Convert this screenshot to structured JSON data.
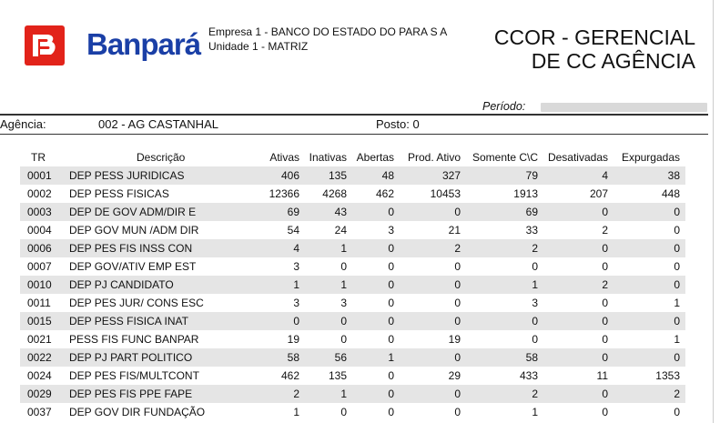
{
  "header": {
    "logo_text": "Banpará",
    "company_label": "Empresa 1 - ",
    "company_name": "BANCO DO ESTADO DO PARA S A",
    "unit_label": "Unidade 1 - ",
    "unit_name": "MATRIZ",
    "report_title_line1": "CCOR - GERENCIAL",
    "report_title_line2": "DE CC AGÊNCIA"
  },
  "filters": {
    "periodo_label": "Período:",
    "agencia_label": "Agência:",
    "agencia_value": "002 - AG CASTANHAL",
    "posto_label": "Posto:",
    "posto_value": "0"
  },
  "colors": {
    "logo_red": "#e2231a",
    "logo_blue": "#1a3fa6",
    "row_shade": "#e5e5e5"
  },
  "table": {
    "headers": [
      "TR",
      "Descrição",
      "Ativas",
      "Inativas",
      "Abertas",
      "Prod. Ativo",
      "Somente C\\C",
      "Desativadas",
      "Expurgadas"
    ],
    "rows": [
      [
        "0001",
        "DEP PESS JURIDICAS",
        "406",
        "135",
        "48",
        "327",
        "79",
        "4",
        "38"
      ],
      [
        "0002",
        "DEP PESS FISICAS",
        "12366",
        "4268",
        "462",
        "10453",
        "1913",
        "207",
        "448"
      ],
      [
        "0003",
        "DEP DE GOV  ADM/DIR E",
        "69",
        "43",
        "0",
        "0",
        "69",
        "0",
        "0"
      ],
      [
        "0004",
        "DEP GOV MUN /ADM DIR",
        "54",
        "24",
        "3",
        "21",
        "33",
        "2",
        "0"
      ],
      [
        "0006",
        "DEP PES FIS INSS CON",
        "4",
        "1",
        "0",
        "2",
        "2",
        "0",
        "0"
      ],
      [
        "0007",
        "DEP GOV/ATIV EMP EST",
        "3",
        "0",
        "0",
        "0",
        "0",
        "0",
        "0"
      ],
      [
        "0010",
        "DEP PJ CANDIDATO",
        "1",
        "1",
        "0",
        "0",
        "1",
        "2",
        "0"
      ],
      [
        "0011",
        "DEP PES JUR/ CONS ESC",
        "3",
        "3",
        "0",
        "0",
        "3",
        "0",
        "1"
      ],
      [
        "0015",
        "DEP PESS FISICA INAT",
        "0",
        "0",
        "0",
        "0",
        "0",
        "0",
        "0"
      ],
      [
        "0021",
        "PESS FIS FUNC BANPAR",
        "19",
        "0",
        "0",
        "19",
        "0",
        "0",
        "1"
      ],
      [
        "0022",
        "DEP PJ PART POLITICO",
        "58",
        "56",
        "1",
        "0",
        "58",
        "0",
        "0"
      ],
      [
        "0024",
        "DEP PES FIS/MULTCONT",
        "462",
        "135",
        "0",
        "29",
        "433",
        "11",
        "1353"
      ],
      [
        "0029",
        "DEP PES FIS PPE FAPE",
        "2",
        "1",
        "0",
        "0",
        "2",
        "0",
        "2"
      ],
      [
        "0037",
        "DEP GOV DIR FUNDAÇÃO",
        "1",
        "0",
        "0",
        "0",
        "1",
        "0",
        "0"
      ]
    ]
  }
}
